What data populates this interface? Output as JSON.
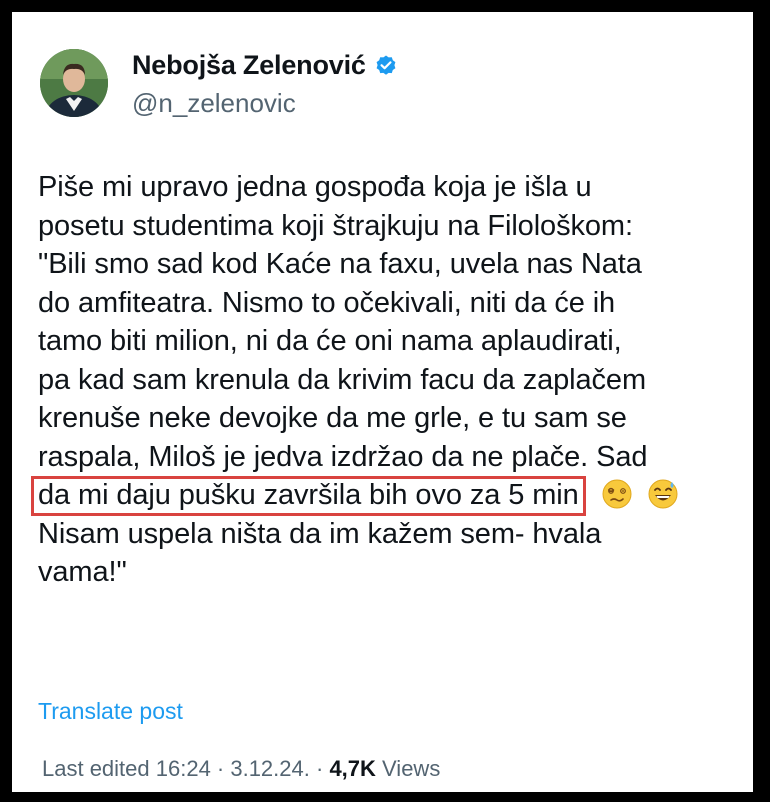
{
  "author": {
    "name": "Nebojša Zelenović",
    "handle": "@n_zelenovic",
    "verified_color": "#1d9bf0"
  },
  "post": {
    "lines": [
      "Piše mi upravo jedna gospođa koja je išla u",
      "posetu studentima koji štrajkuju na Filološkom:",
      "\"Bili smo sad kod Kaće na faxu, uvela nas Nata",
      "do amfiteatra. Nismo to očekivali, niti da će ih",
      "tamo biti milion, ni da će oni nama aplaudirati,",
      "pa kad sam krenula da krivim facu da zaplačem",
      "krenuše neke devojke da me grle, e tu sam se",
      "raspala, Miloš je jedva izdržao da ne plače. Sad"
    ],
    "highlighted_line": "da mi daju pušku završila bih ovo za 5 min",
    "emojis": [
      "woozy-face-icon",
      "grinning-sweat-face-icon"
    ],
    "tail_lines": [
      "Nisam uspela ništa da im kažem sem- hvala",
      "vama!\""
    ]
  },
  "translate_label": "Translate post",
  "meta": {
    "edited": "Last edited 16:24 · 3.12.24.",
    "separator": " · ",
    "views_count": "4,7K",
    "views_label": " Views"
  },
  "colors": {
    "highlight_border": "#d9433f",
    "link": "#1d9bf0",
    "secondary_text": "#536471",
    "frame": "#000000"
  }
}
